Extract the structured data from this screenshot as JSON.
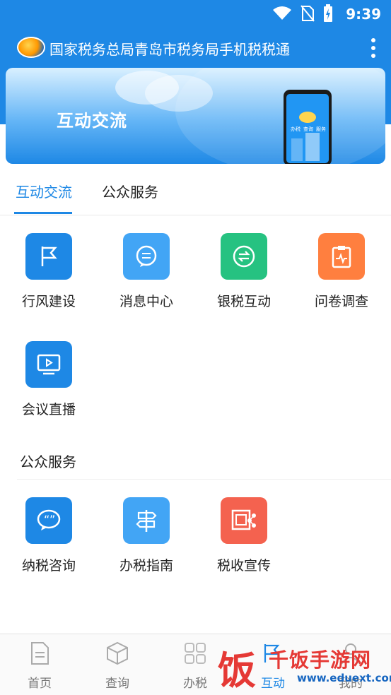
{
  "status_bar": {
    "time": "9:39"
  },
  "app_bar": {
    "title": "国家税务总局青岛市税务局手机税税通"
  },
  "banner": {
    "title": "互动交流",
    "phone_texts": [
      "办税",
      "查询",
      "服务"
    ]
  },
  "tabs": [
    {
      "label": "互动交流",
      "active": true
    },
    {
      "label": "公众服务",
      "active": false
    }
  ],
  "interaction_items": [
    {
      "label": "行风建设",
      "icon": "flag-icon",
      "color": "#1e88e5"
    },
    {
      "label": "消息中心",
      "icon": "message-icon",
      "color": "#42a5f5"
    },
    {
      "label": "银税互动",
      "icon": "exchange-icon",
      "color": "#26c281"
    },
    {
      "label": "问卷调查",
      "icon": "clipboard-icon",
      "color": "#ff7f3f"
    },
    {
      "label": "会议直播",
      "icon": "tv-play-icon",
      "color": "#1e88e5"
    }
  ],
  "public_service": {
    "title": "公众服务",
    "items": [
      {
        "label": "纳税咨询",
        "icon": "chat-quote-icon",
        "color": "#1e88e5"
      },
      {
        "label": "办税指南",
        "icon": "signpost-icon",
        "color": "#42a5f5"
      },
      {
        "label": "税收宣传",
        "icon": "share-board-icon",
        "color": "#f4624f"
      }
    ]
  },
  "bottom_nav": [
    {
      "label": "首页",
      "icon": "document-icon"
    },
    {
      "label": "查询",
      "icon": "cube-icon"
    },
    {
      "label": "办税",
      "icon": "grid-icon"
    },
    {
      "label": "互动",
      "icon": "interact-icon"
    },
    {
      "label": "我的",
      "icon": "user-icon"
    }
  ],
  "watermark": {
    "big_char": "饭",
    "text": "千饭手游网",
    "url": "www.eduext.com"
  }
}
